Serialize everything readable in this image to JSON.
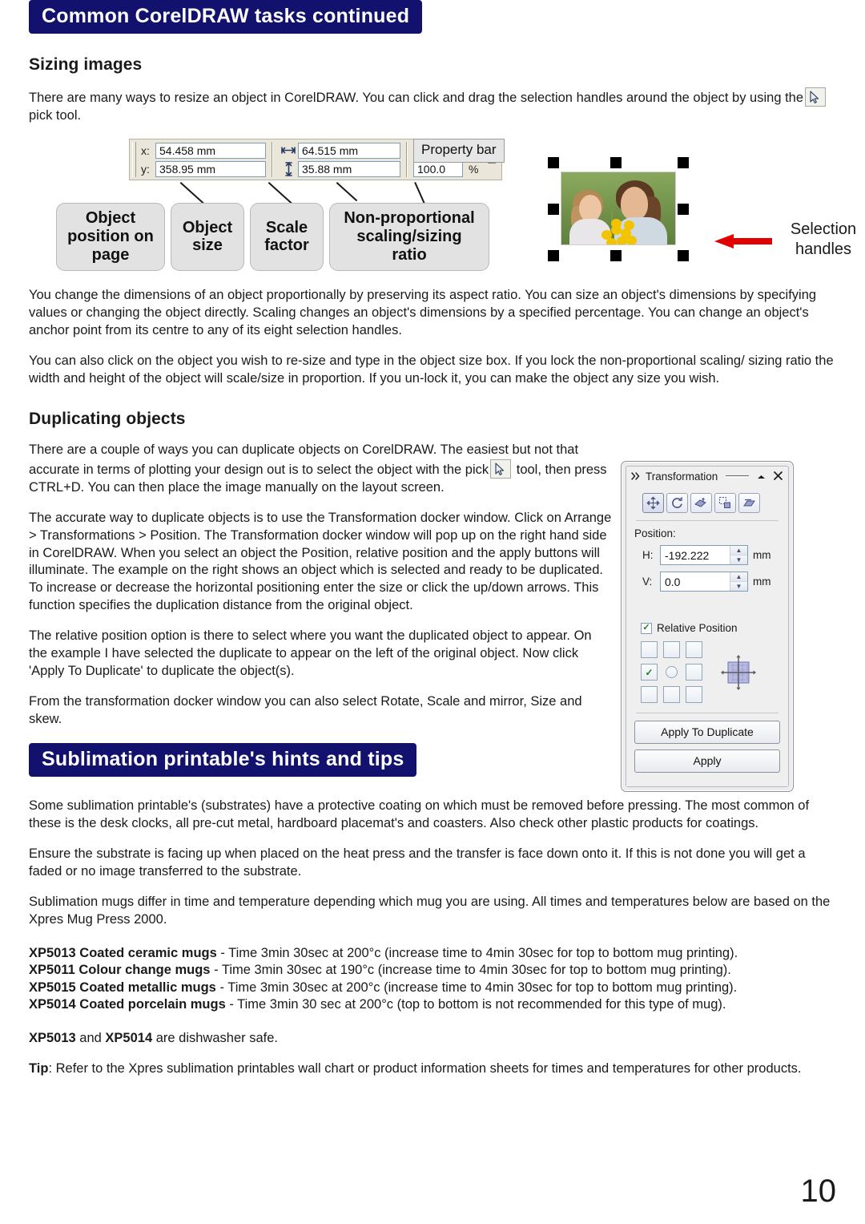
{
  "document": {
    "page_number": "10",
    "accent_color": "#12126e"
  },
  "section_sizing": {
    "banner": "Common CorelDRAW tasks continued",
    "subheading": "Sizing images",
    "intro_part1": "There are many ways to resize an object in CorelDRAW. You can click and drag the selection handles around the object by using the",
    "intro_part2": "pick tool.",
    "paragraph_2": "You change the dimensions of an object proportionally by preserving its aspect ratio. You can size an object's dimensions by specifying values or changing the object directly. Scaling changes an object's dimensions by a specified percentage. You can change an object's anchor point from its centre to any of its eight selection handles.",
    "paragraph_3": "You can also click on the object you wish to re-size and type in the object size box. If you lock the non-proportional scaling/ sizing ratio the width and height of the object will scale/size in proportion. If you un-lock it, you can make the object any size you wish."
  },
  "property_bar": {
    "tag_label": "Property bar",
    "x_label": "x:",
    "y_label": "y:",
    "x_value": "54.458 mm",
    "y_value": "358.95 mm",
    "width_value": "64.515 mm",
    "height_value": "35.88 mm",
    "scale_h_value": "100.0",
    "scale_v_value": "100.0",
    "percent_symbol": "%",
    "width_icon": "horizontal-size-icon",
    "height_icon": "vertical-size-icon",
    "lock_icon": "lock-icon",
    "callouts": [
      "Object position on page",
      "Object size",
      "Scale factor",
      "Non-proportional scaling/sizing ratio"
    ]
  },
  "selection_figure": {
    "label": "Selection handles",
    "arrow_icon": "left-arrow-icon",
    "photo_alt": "woman-and-girl-with-flowers-photo",
    "handle_count": 8
  },
  "section_duplicating": {
    "subheading": "Duplicating objects",
    "paragraph_1_part1": "There are a couple of ways you can duplicate objects on CorelDRAW. The easiest but not that accurate in terms of plotting your design out is to select the object with the pick",
    "paragraph_1_part2": "tool, then press CTRL+D. You can then place the image manually on the layout screen.",
    "paragraph_2": "The accurate way to duplicate objects is to use the Transformation docker window. Click on Arrange > Transformations > Position. The Transformation docker window will pop up on the right hand side in CorelDRAW. When you select an object the Position, relative position and the apply buttons will illuminate. The example on the right shows an object which is selected and ready to be duplicated. To increase or decrease the horizontal positioning enter the size or click the up/down arrows. This function specifies the duplication distance from the original object.",
    "paragraph_3": "The relative position option is there to select where you want the duplicated object to appear. On the example I have selected the duplicate to appear on the left of the original object. Now click 'Apply To Duplicate' to duplicate the object(s).",
    "paragraph_4": "From the transformation docker window you can also select Rotate, Scale and mirror, Size and skew."
  },
  "transformation_docker": {
    "title": "Transformation",
    "expand_icon": "double-chevron-icon",
    "collapse_icon": "collapse-up-icon",
    "close_icon": "close-icon",
    "tools": [
      "position-tool-icon",
      "rotate-tool-icon",
      "scale-mirror-tool-icon",
      "size-tool-icon",
      "skew-tool-icon"
    ],
    "position_label": "Position:",
    "h_label": "H:",
    "h_value": "-192.222",
    "v_label": "V:",
    "v_value": "0.0",
    "unit": "mm",
    "relative_position_label": "Relative Position",
    "relative_position_checked": true,
    "anchor_selected": "middle-left",
    "apply_to_duplicate_label": "Apply To Duplicate",
    "apply_label": "Apply"
  },
  "section_sublimation": {
    "banner": "Sublimation printable's hints and tips",
    "paragraph_1": "Some sublimation printable's (substrates) have a protective coating on which must be removed before pressing. The most common of these is the desk clocks, all pre-cut metal, hardboard placemat's and coasters. Also check other plastic products for coatings.",
    "paragraph_2": "Ensure the substrate is facing up when placed on the heat press and the transfer is face down onto it. If this is not done you will get a faded or no image transferred to the substrate.",
    "paragraph_3": "Sublimation mugs differ in time and temperature depending which mug you are using. All times and temperatures below are based on the Xpres Mug Press 2000.",
    "mug_specs": [
      {
        "code_and_name": "XP5013 Coated ceramic mugs",
        "details": " - Time 3min 30sec at 200°c (increase time to 4min 30sec for top to bottom mug printing)."
      },
      {
        "code_and_name": "XP5011 Colour change mugs",
        "details": " -  Time 3min 30sec at 190°c (increase time to 4min 30sec for top to bottom mug printing)."
      },
      {
        "code_and_name": "XP5015 Coated metallic mugs",
        "details": " - Time 3min 30sec at 200°c (increase time to 4min 30sec for top to bottom mug printing)."
      },
      {
        "code_and_name": "XP5014 Coated porcelain mugs",
        "details": " - Time 3min 30 sec at 200°c (top to bottom is not recommended for this type of mug)."
      }
    ],
    "dishwasher_code_1": "XP5013",
    "dishwasher_mid": " and ",
    "dishwasher_code_2": "XP5014",
    "dishwasher_tail": " are dishwasher safe.",
    "tip_label": "Tip",
    "tip_text": ": Refer to the Xpres sublimation printables wall chart or product information sheets for times and temperatures for other products."
  }
}
